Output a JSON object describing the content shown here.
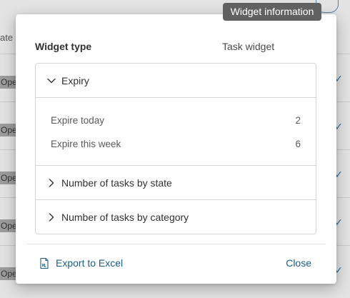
{
  "background": {
    "header_partial": "ate",
    "row_badge_partial": "Ope"
  },
  "tooltip": {
    "text": "Widget information"
  },
  "modal": {
    "widget_type_label": "Widget type",
    "widget_type_value": "Task widget",
    "sections": [
      {
        "label": "Expiry",
        "expanded": true,
        "items": [
          {
            "label": "Expire today",
            "value": "2"
          },
          {
            "label": "Expire this week",
            "value": "6"
          }
        ]
      },
      {
        "label": "Number of tasks by state",
        "expanded": false
      },
      {
        "label": "Number of tasks by category",
        "expanded": false
      }
    ],
    "footer": {
      "export_label": "Export to Excel",
      "export_icon": "excel-file-icon",
      "close_label": "Close"
    }
  },
  "colors": {
    "link": "#1a5e8a",
    "tooltip_bg": "#616161",
    "border": "#d6d6d6"
  }
}
